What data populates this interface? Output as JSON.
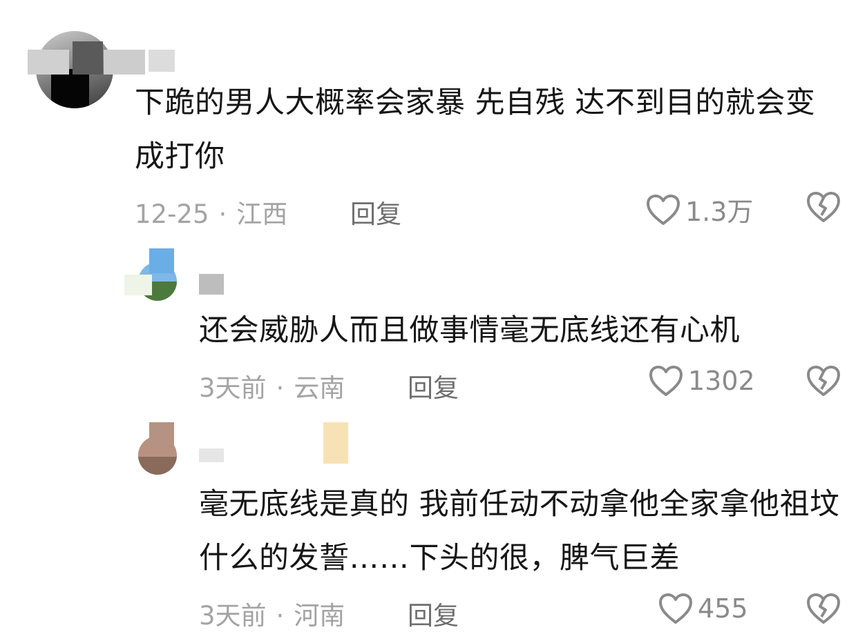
{
  "comments": [
    {
      "text": "下跪的男人大概率会家暴 先自残 达不到目的就会变成打你",
      "date": "12-25",
      "location": "江西",
      "reply_label": "回复",
      "likes": "1.3万"
    },
    {
      "text": "还会威胁人而且做事情毫无底线还有心机",
      "date": "3天前",
      "location": "云南",
      "reply_label": "回复",
      "likes": "1302"
    },
    {
      "text": "毫无底线是真的 我前任动不动拿他全家拿他祖坟什么的发誓……下头的很，脾气巨差",
      "date": "3天前",
      "location": "河南",
      "reply_label": "回复",
      "likes": "455"
    }
  ],
  "meta_separator": "·",
  "icons": {
    "like": "heart-outline-icon",
    "dislike": "broken-heart-icon"
  },
  "colors": {
    "text": "#161616",
    "meta": "#a3a3a3",
    "reply": "#6e6e6e",
    "icon": "#8a8a8a"
  }
}
